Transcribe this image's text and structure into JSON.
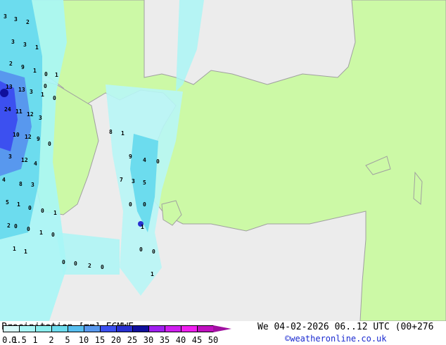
{
  "colors": {
    "land": "#ccf9a6",
    "sea": "#ececec",
    "border": "#a0a0a0"
  },
  "map_values": [
    "3",
    "3",
    "2",
    "3",
    "3",
    "1",
    "2",
    "9",
    "1",
    "0",
    "1",
    "0",
    "13",
    "13",
    "3",
    "1",
    "0",
    "24",
    "11",
    "12",
    "3",
    "10",
    "12",
    "9",
    "0",
    "3",
    "12",
    "4",
    "4",
    "8",
    "3",
    "5",
    "1",
    "0",
    "0",
    "1",
    "2",
    "0",
    "0",
    "1",
    "0",
    "1",
    "1",
    "0",
    "0",
    "2",
    "0",
    "8",
    "1",
    "9",
    "4",
    "0",
    "7",
    "3",
    "5",
    "0",
    "0",
    "1",
    "0",
    "0",
    "1"
  ],
  "footer": {
    "title": "Precipitation [mm]  ECMWF",
    "datetime": "We 04-02-2026 06..12 UTC (00+276",
    "credit": "©weatheronline.co.uk"
  },
  "legend": {
    "labels": [
      "0.1",
      "0.5",
      "1",
      "2",
      "5",
      "10",
      "15",
      "20",
      "25",
      "30",
      "35",
      "40",
      "45",
      "50"
    ],
    "colors": [
      "#d8fafa",
      "#a8f6f6",
      "#8ceeee",
      "#6cdcee",
      "#58bff0",
      "#5898ee",
      "#3c50f0",
      "#2830d0",
      "#10109c",
      "#a020f0",
      "#d020f0",
      "#f020f0",
      "#c010c0"
    ]
  }
}
